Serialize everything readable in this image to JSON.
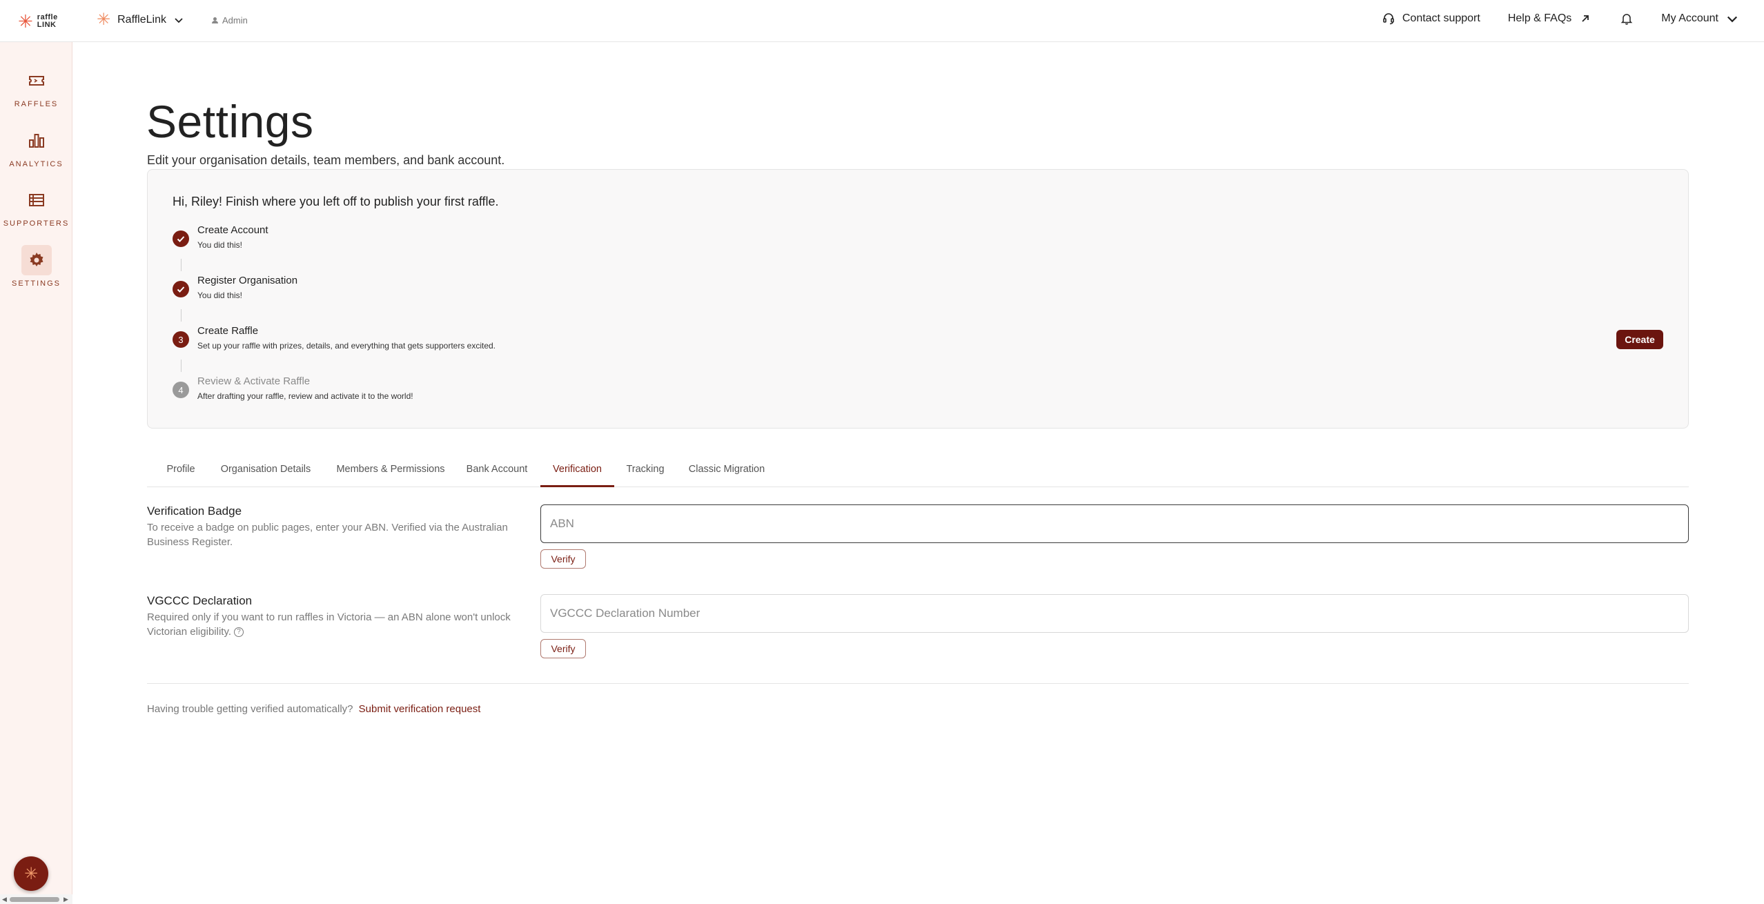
{
  "brand": {
    "logo_line1": "raffle",
    "logo_line2": "LINK",
    "accent": "#7a1d12",
    "logo_color": "#e8553a"
  },
  "header": {
    "org_name": "RaffleLink",
    "role": "Admin",
    "contact_support": "Contact support",
    "help_faqs": "Help & FAQs",
    "my_account": "My Account"
  },
  "sidebar": {
    "items": [
      {
        "label": "RAFFLES",
        "icon": "ticket-icon"
      },
      {
        "label": "ANALYTICS",
        "icon": "bar-chart-icon"
      },
      {
        "label": "SUPPORTERS",
        "icon": "list-icon"
      },
      {
        "label": "SETTINGS",
        "icon": "gear-icon",
        "active": true
      }
    ]
  },
  "page": {
    "title": "Settings",
    "subtitle": "Edit your organisation details, team members, and bank account."
  },
  "onboarding": {
    "title": "Hi, Riley! Finish where you left off to publish your first raffle.",
    "steps": [
      {
        "title": "Create Account",
        "desc": "You did this!",
        "status": "done"
      },
      {
        "title": "Register Organisation",
        "desc": "You did this!",
        "status": "done"
      },
      {
        "number": "3",
        "title": "Create Raffle",
        "desc": "Set up your raffle with prizes, details, and everything that gets supporters excited.",
        "status": "current"
      },
      {
        "number": "4",
        "title": "Review & Activate Raffle",
        "desc": "After drafting your raffle, review and activate it to the world!",
        "status": "pending"
      }
    ],
    "create_label": "Create"
  },
  "tabs": [
    {
      "label": "Profile"
    },
    {
      "label": "Organisation Details"
    },
    {
      "label": "Members & Permissions"
    },
    {
      "label": "Bank Account"
    },
    {
      "label": "Verification",
      "active": true
    },
    {
      "label": "Tracking"
    },
    {
      "label": "Classic Migration"
    }
  ],
  "verification": {
    "badge": {
      "label": "Verification Badge",
      "help": "To receive a badge on public pages, enter your ABN. Verified via the Australian Business Register.",
      "placeholder": "ABN",
      "value": "",
      "button": "Verify"
    },
    "vgccc": {
      "label": "VGCCC Declaration",
      "help": "Required only if you want to run raffles in Victoria — an ABN alone won't unlock Victorian eligibility.",
      "placeholder": "VGCCC Declaration Number",
      "value": "",
      "button": "Verify"
    },
    "trouble_text": "Having trouble getting verified automatically?",
    "trouble_link": "Submit verification request"
  }
}
